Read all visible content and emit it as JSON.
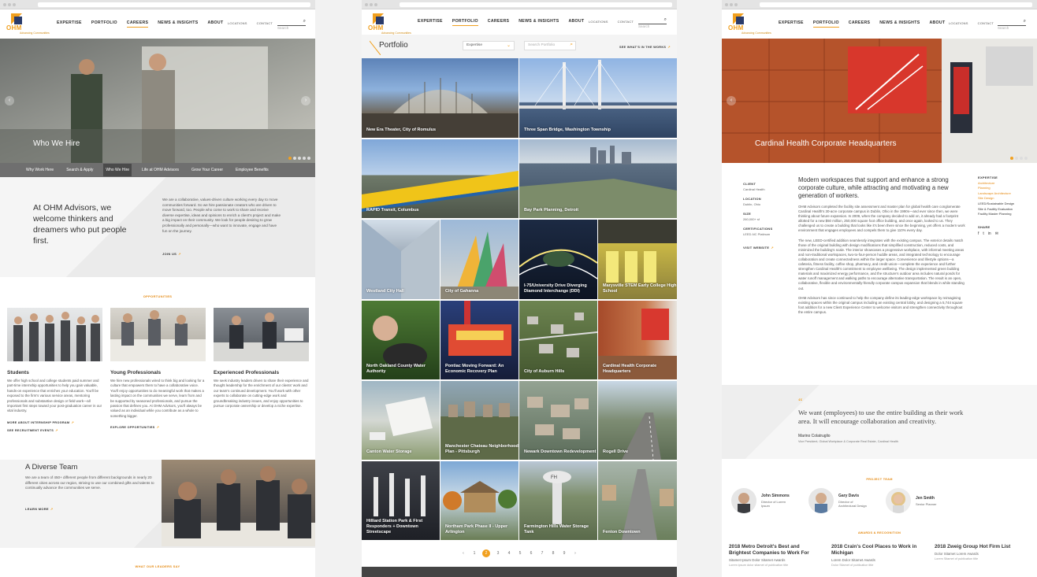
{
  "brand": {
    "name": "OHM",
    "tagline": "Advancing Communities",
    "accent": "#f1a01f"
  },
  "nav": {
    "items": [
      "EXPERTISE",
      "PORTFOLIO",
      "CAREERS",
      "NEWS & INSIGHTS",
      "ABOUT"
    ],
    "utility": [
      "LOCATIONS",
      "CONTACT"
    ],
    "search_placeholder": "Search"
  },
  "careers": {
    "hero_title": "Who We Hire",
    "subnav": [
      "Why Work Here",
      "Search & Apply",
      "Who We Hire",
      "Life at OHM Advisors",
      "Grow Your Career",
      "Employee Benefits"
    ],
    "intro_heading": "At OHM Advisors, we welcome thinkers and dreamers who put people first.",
    "intro_text": "We are a collaborative, values-driven culture working every day to move communities forward. So we hire passionate creators who are driven to move forward, too. People who come to work to share and receive diverse expertise, ideas and opinions to enrich a client's project and make a big impact on their community. We look for people desiring to grow professionally and personally—who want to innovate, engage and have fun on the journey.",
    "join_link": "JOIN US",
    "opportunities_label": "OPPORTUNITIES",
    "cards": [
      {
        "title": "Students",
        "text": "We offer high school and college students paid summer and part-time internship opportunities to help you gain valuable, hands-on experience that enriches your education. You'll be exposed to the firm's various service areas, mentoring professionals and substantive design or field work—all important first steps toward your post-graduation career in our vital industry.",
        "links": [
          "MORE ABOUT INTERNSHIP PROGRAM",
          "SEE RECRUITMENT EVENTS"
        ]
      },
      {
        "title": "Young Professionals",
        "text": "We hire new professionals wired to think big and looking for a culture that empowers them to have a collaborative voice. You'll enjoy opportunities to do meaningful work that makes a lasting impact on the communities we serve, learn from and be supported by seasoned professionals, and pursue the passion that defines you. At OHM Advisors, you'll always be valued as an individual while you contribute as a whole to something bigger.",
        "links": [
          "EXPLORE OPPORTUNITIES"
        ]
      },
      {
        "title": "Experienced Professionals",
        "text": "We seek industry leaders driven to share their experience and thought leadership for the enrichment of our clients' work and our team's continued development. You'll work with other experts to collaborate on cutting-edge work and groundbreaking industry issues, and enjoy opportunities to pursue corporate ownership or develop a niche expertise.",
        "links": []
      }
    ],
    "diverse_title": "A Diverse Team",
    "diverse_text": "We are a team of 450+ different people from different backgrounds in nearly 20 different cities across our region, striving to use our combined gifts and talents to continually advance the communities we serve.",
    "learn_more": "LEARN MORE",
    "leaders_label": "WHAT OUR LEADERS SAY"
  },
  "portfolio": {
    "title": "Portfolio",
    "filter_label": "Expertise",
    "search_placeholder": "Search Portfolio",
    "works_link": "SEE WHAT'S IN THE WORKS",
    "tiles": [
      "New Era Theater, City of Romulus",
      "Three Span Bridge, Washington Township",
      "RAPID Transit, Columbus",
      "Bay Park Planning, Detroit",
      "Westland City Hall",
      "City of Gahanna",
      "I-75/University Drive Diverging Diamond Interchange (DDI)",
      "Marysville STEM Early College High School",
      "North Oakland County Water Authority",
      "Pontiac Moving Forward: An Economic Recovery Plan",
      "City of Auburn Hills",
      "Cardinal Health Corporate Headquarters",
      "Canton Water Storage",
      "Manchester Chateau Neighborhood Plan - Pittsburgh",
      "Newark Downtown Redevelopment",
      "Rogell Drive",
      "Hilliard Station Park & First Responders + Downtown Streetscape",
      "Northam Park Phase II - Upper Arlington",
      "Farmington Hills Water Storage Tank",
      "Fenton Downtown"
    ],
    "pages": [
      "1",
      "2",
      "3",
      "4",
      "5",
      "6",
      "7",
      "8",
      "9"
    ],
    "current_page": "2"
  },
  "project": {
    "hero_title": "Cardinal Health Corporate Headquarters",
    "meta": [
      {
        "label": "CLIENT",
        "value": "Cardinal Health"
      },
      {
        "label": "LOCATION",
        "value": "Dublin, Ohio"
      },
      {
        "label": "SIZE",
        "value": "260,000+ sf"
      },
      {
        "label": "CERTIFICATIONS",
        "value": "LEED-NC Platinum"
      }
    ],
    "visit_website": "VISIT WEBSITE",
    "lead": "Modern workspaces that support and enhance a strong corporate culture, while attracting and motivating a new generation of workers.",
    "body": [
      "OHM Advisors completed the facility site assessment and master plan for global health care conglomerate Cardinal Health's 30-acre corporate campus in Dublin, Ohio in the 1990s—and ever since then, we were thinking about future expansion. In 2009, when the company decided to add on, it already had a footprint allotted for a new $50 million, 250,000 square foot office building, and once again, looked to us. They challenged us to create a building that looks like it's been there since the beginning, yet offers a modern work environment that engages employees and compels them to give 110% every day.",
      "The new, LEED-certified addition seamlessly integrates with the existing campus. The exterior details match those of the original building with design modifications that simplified construction, reduced costs, and minimized the building's scale. The interior showcases a progressive workplace, with informal meeting areas and non-traditional workspaces, two-to-four-person huddle areas, and integrated technology to encourage collaboration and create connectedness within the larger space. Convenience and lifestyle options—a cafeteria, fitness facility, coffee shop, pharmacy, and credit union—complete the experience and further strengthen Cardinal Health's commitment to employee wellbeing. The design implemented green building materials and maximized energy performance, and the structure's outdoor area includes natural ponds for water runoff management and walking paths to encourage alternative transportation. The result is an open, collaborative, flexible and environmentally-friendly corporate campus expansion that blends in while standing out.",
      "OHM Advisors has since continued to help the company define its leading-edge workspace by reimagining existing spaces within the original campus including an existing central lobby, and designing a 5,744 square foot addition for a new Client Experience Center to welcome visitors and strengthen connectivity throughout the entire campus."
    ],
    "expertise_label": "EXPERTISE",
    "expertise": [
      "Architecture",
      "Planning",
      "Landscape Architecture",
      "Site Design",
      "LEED/Sustainable Design",
      "Site & Facility Evaluation",
      "Facility Master Planning"
    ],
    "share_label": "SHARE",
    "share_icons": [
      "f",
      "t",
      "in",
      "✉"
    ],
    "quote": "We want (employees) to use the entire building as their work area. It will encourage collaboration and creativity.",
    "quote_author": "Marino Colatruglio",
    "quote_role": "Vice President, Global Workplace & Corporate Real Estate, Cardinal Health",
    "team_label": "PROJECT TEAM",
    "team": [
      {
        "name": "John Simmons",
        "role": "Director of Lorem Ipsum"
      },
      {
        "name": "Gary Davis",
        "role": "Director of Architectural Design"
      },
      {
        "name": "Jen Smith",
        "role": "Senior Planner"
      }
    ],
    "awards_label": "AWARDS & RECOGNITION",
    "awards": [
      {
        "title": "2018 Metro Detroit's Best and Brightest Companies to Work For",
        "org": "Sitamet Ipsum Dolor Sitamet Awards",
        "note": "Lorem ipsum dolor sitamet of publication title"
      },
      {
        "title": "2018 Crain's Cool Places to Work in Michigan",
        "org": "Lorem Dolor Sitamet Awards",
        "note": "Dolor Sitamet of publication title"
      },
      {
        "title": "2018 Zweig Group Hot Firm List",
        "org": "Dolor Sitamet Lorem Awards",
        "note": "Lorem Sitamet of publication title"
      }
    ]
  }
}
